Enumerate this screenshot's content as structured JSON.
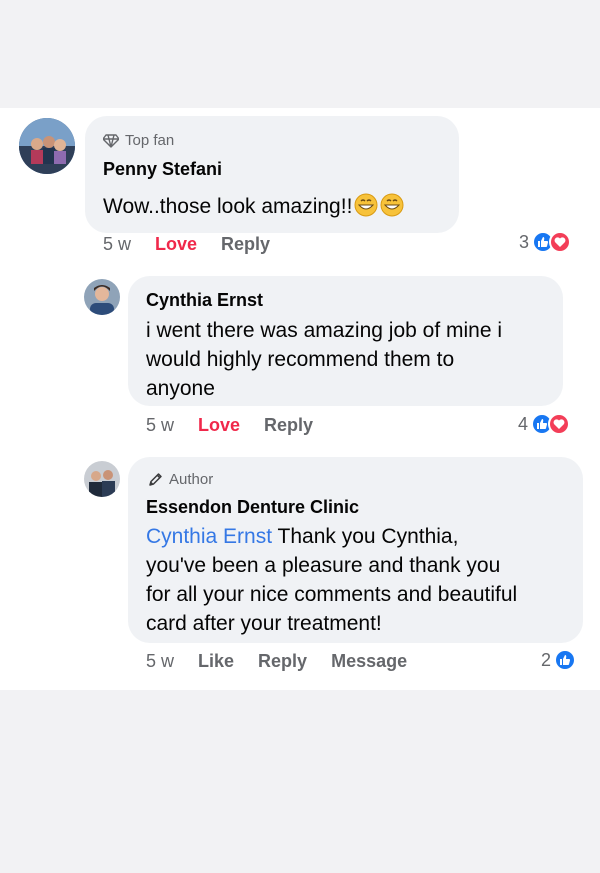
{
  "comments": [
    {
      "badge": "Top fan",
      "badge_icon": "diamond-icon",
      "author": "Penny Stefani",
      "text": "Wow..those look amazing!!",
      "emoji_count": 2,
      "time": "5 w",
      "action_primary": "Love",
      "action_reply": "Reply",
      "reaction_count": "3",
      "reactions": [
        "like",
        "love"
      ]
    },
    {
      "author": "Cynthia Ernst",
      "text_lines": [
        "i went there was amazing job of mine i",
        "would highly recommend them to",
        "anyone"
      ],
      "time": "5 w",
      "action_primary": "Love",
      "action_reply": "Reply",
      "reaction_count": "4",
      "reactions": [
        "like",
        "love"
      ]
    },
    {
      "badge": "Author",
      "badge_icon": "pencil-icon",
      "author": "Essendon Denture Clinic",
      "mention": "Cynthia Ernst",
      "text_first": " Thank you Cynthia,",
      "text_lines": [
        "you've been a pleasure and thank you",
        "for all your nice comments and beautiful",
        "card after your treatment!"
      ],
      "time": "5 w",
      "action_primary": "Like",
      "action_reply": "Reply",
      "action_message": "Message",
      "reaction_count": "2",
      "reactions": [
        "like"
      ]
    }
  ],
  "colors": {
    "background": "#f2f2f4",
    "bubble": "#f0f2f5",
    "love_red": "#f0284a",
    "like_blue": "#1877f2",
    "mention_blue": "#3578e5",
    "secondary_text": "#65676b"
  }
}
